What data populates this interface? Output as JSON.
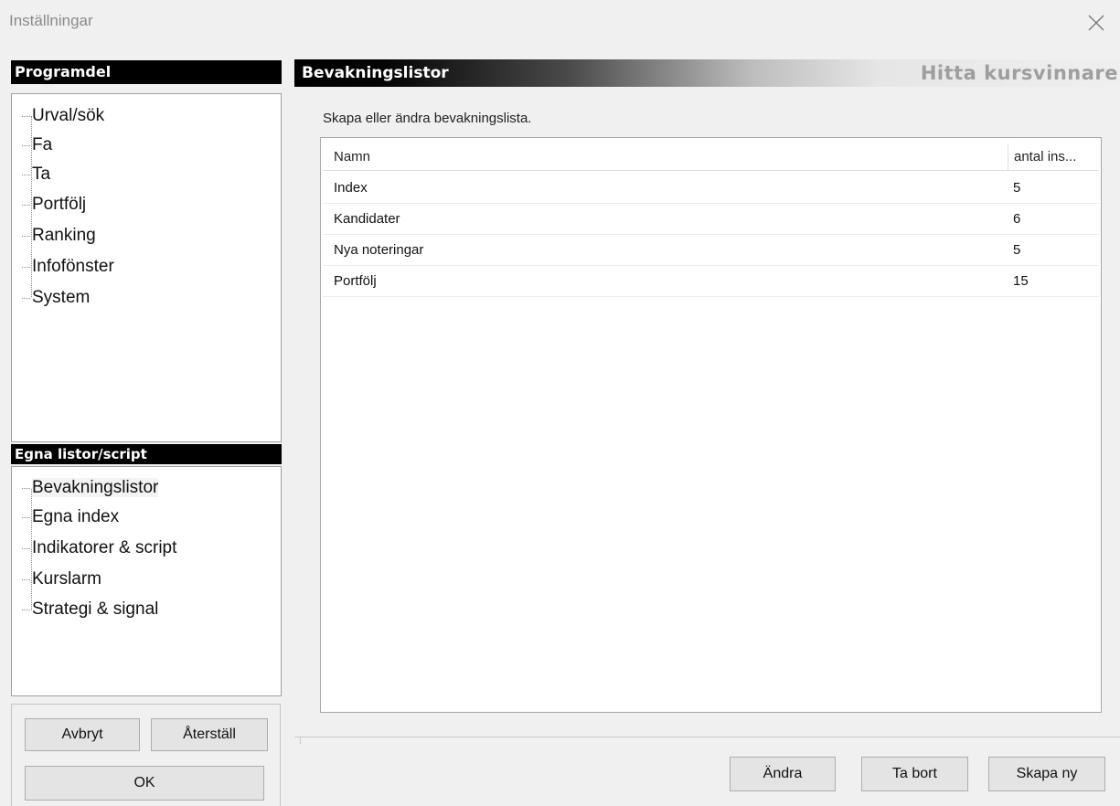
{
  "window": {
    "title": "Inställningar"
  },
  "sidebar": {
    "program_header": "Programdel",
    "program_items": [
      {
        "label": "Urval/sök"
      },
      {
        "label": "Fa"
      },
      {
        "label": "Ta"
      },
      {
        "label": "Portfölj"
      },
      {
        "label": "Ranking"
      },
      {
        "label": "Infofönster"
      },
      {
        "label": "System"
      }
    ],
    "lists_header": "Egna listor/script",
    "list_items": [
      {
        "label": "Bevakningslistor"
      },
      {
        "label": "Egna index"
      },
      {
        "label": "Indikatorer & script"
      },
      {
        "label": "Kurslarm"
      },
      {
        "label": "Strategi & signal"
      }
    ],
    "buttons": {
      "cancel": "Avbryt",
      "reset": "Återställ",
      "ok": "OK"
    }
  },
  "main": {
    "title": "Bevakningslistor",
    "brand": "Hitta kursvinnare",
    "description": "Skapa eller ändra bevakningslista.",
    "table": {
      "columns": [
        "Namn",
        "antal ins..."
      ],
      "rows": [
        {
          "name": "Index",
          "count": "5"
        },
        {
          "name": "Kandidater",
          "count": "6"
        },
        {
          "name": "Nya noteringar",
          "count": "5"
        },
        {
          "name": "Portfölj",
          "count": "15"
        }
      ]
    },
    "buttons": {
      "edit": "Ändra",
      "delete": "Ta bort",
      "create": "Skapa ny"
    }
  },
  "icons": {
    "close": "close-icon"
  },
  "colors": {
    "header_bg": "#000000",
    "window_bg": "#f0f0f0"
  }
}
